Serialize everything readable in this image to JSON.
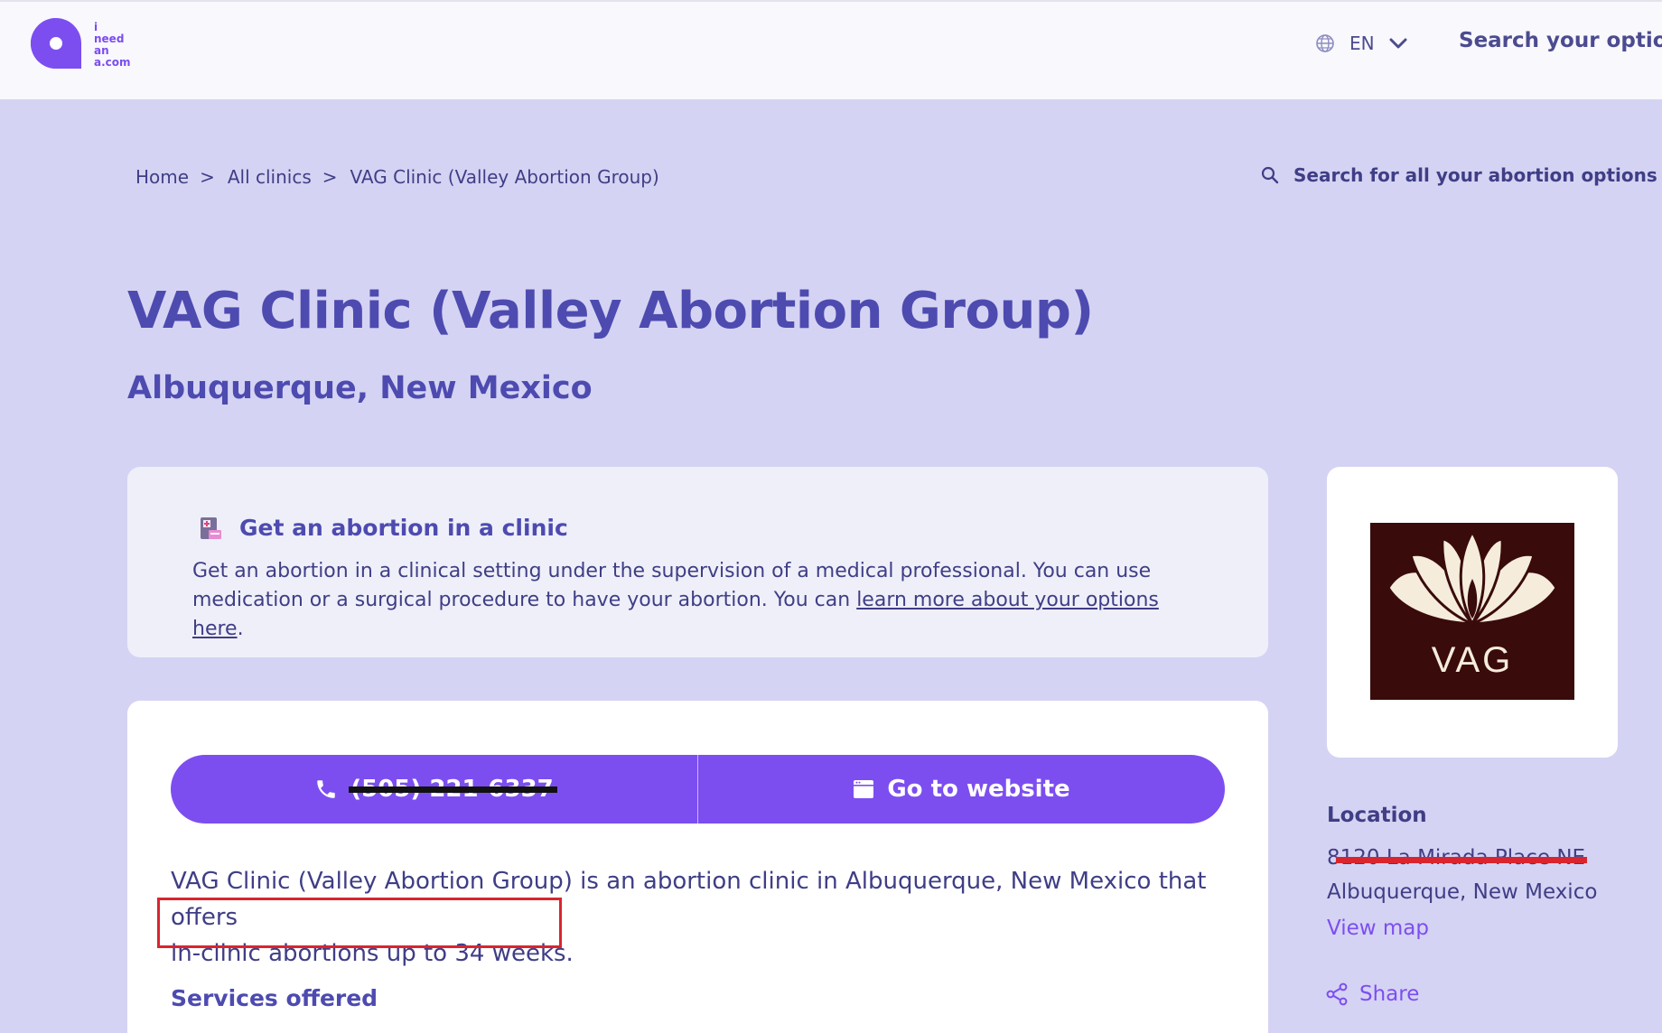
{
  "header": {
    "logo_lines": [
      "i",
      "need",
      "an",
      "a.com"
    ],
    "language": "EN",
    "search_label": "Search your options"
  },
  "breadcrumb": {
    "items": [
      "Home",
      "All clinics",
      "VAG Clinic (Valley Abortion Group)"
    ],
    "separator": ">"
  },
  "search_options_label": "Search for all your abortion options",
  "clinic": {
    "name": "VAG Clinic (Valley Abortion Group)",
    "city_state": "Albuquerque, New Mexico"
  },
  "info_card": {
    "title": "Get an abortion in a clinic",
    "text_before": "Get an abortion in a clinical setting under the supervision of a medical professional. You can use medication or a surgical procedure to have your abortion. You can ",
    "link_text": "learn more about your options here",
    "text_after": "."
  },
  "cta": {
    "phone": "(505) 221-6337",
    "website_label": "Go to website"
  },
  "description": {
    "line1": "VAG Clinic (Valley Abortion Group) is an abortion clinic in Albuquerque, New Mexico that offers",
    "line2": "in-clinic abortions up to 34 weeks."
  },
  "services_heading": "Services offered",
  "sidebar": {
    "logo_text": "VAG",
    "location_heading": "Location",
    "address": "8120 La Mirada Place NE",
    "city_state": "Albuquerque, New Mexico",
    "view_map_label": "View map",
    "share_label": "Share"
  },
  "colors": {
    "accent": "#7c4ef0",
    "heading": "#4d4bb0",
    "text": "#3f3e86",
    "background": "#d5d3f3",
    "annotation_red": "#d9252f"
  }
}
